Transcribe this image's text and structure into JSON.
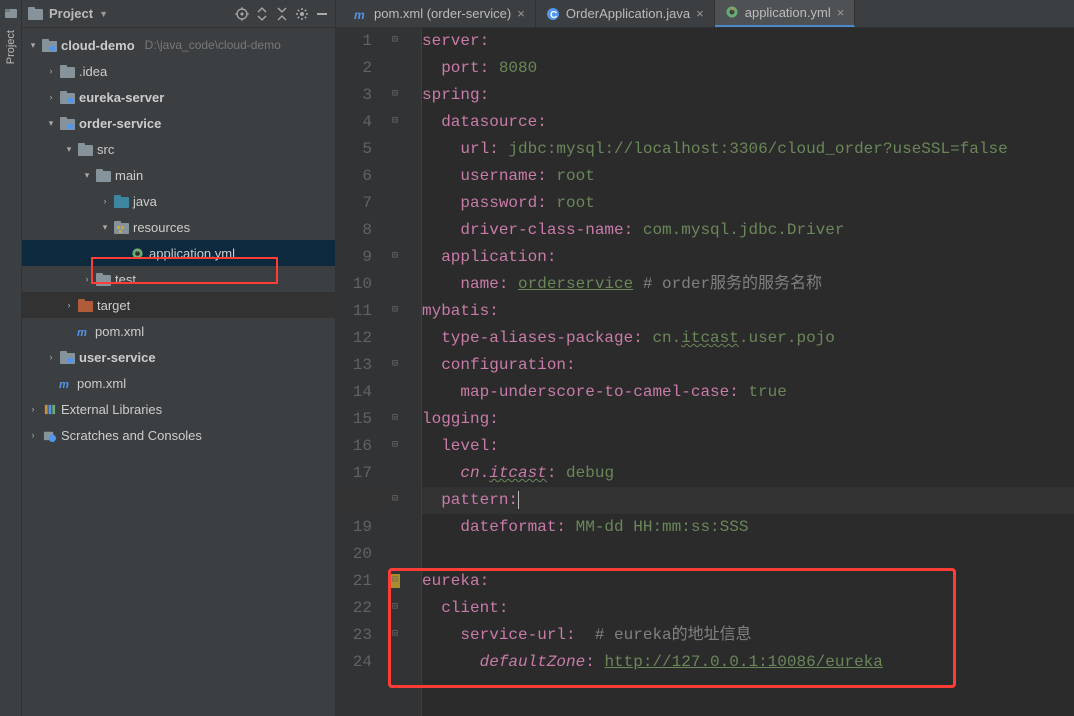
{
  "sidebar": {
    "title": "Project",
    "root": {
      "label": "cloud-demo",
      "hint": "D:\\java_code\\cloud-demo"
    },
    "nodes": {
      "idea": ".idea",
      "eureka": "eureka-server",
      "order": "order-service",
      "src": "src",
      "main": "main",
      "java": "java",
      "resources": "resources",
      "appyml": "application.yml",
      "test": "test",
      "target": "target",
      "pom1": "pom.xml",
      "user": "user-service",
      "pom2": "pom.xml",
      "extlib": "External Libraries",
      "scratch": "Scratches and Consoles"
    }
  },
  "tabs": {
    "t1": "pom.xml (order-service)",
    "t2": "OrderApplication.java",
    "t3": "application.yml"
  },
  "code": {
    "l1a": "server",
    "l1b": ":",
    "l2a": "  port",
    "l2b": ": ",
    "l2c": "8080",
    "l3a": "spring",
    "l3b": ":",
    "l4a": "  datasource",
    "l4b": ":",
    "l5a": "    url",
    "l5b": ": ",
    "l5c": "jdbc:mysql://localhost:3306/cloud_order?useSSL=false",
    "l6a": "    username",
    "l6b": ": ",
    "l6c": "root",
    "l7a": "    password",
    "l7b": ": ",
    "l7c": "root",
    "l8a": "    driver-class-name",
    "l8b": ": ",
    "l8c": "com.mysql.jdbc.Driver",
    "l9a": "  application",
    "l9b": ":",
    "l10a": "    name",
    "l10b": ": ",
    "l10c": "orderservice",
    "l10d": " # order服务的服务名称",
    "l11a": "mybatis",
    "l11b": ":",
    "l12a": "  type-aliases-package",
    "l12b": ": ",
    "l12c": "cn.",
    "l12d": "itcast",
    "l12e": ".user.pojo",
    "l13a": "  configuration",
    "l13b": ":",
    "l14a": "    map-underscore-to-camel-case",
    "l14b": ": ",
    "l14c": "true",
    "l15a": "logging",
    "l15b": ":",
    "l16a": "  level",
    "l16b": ":",
    "l17a": "    cn",
    "l17b": ".",
    "l17c": "itcast",
    "l17d": ": ",
    "l17e": "debug",
    "l18a": "  pattern",
    "l18b": ":",
    "l19a": "    dateformat",
    "l19b": ": ",
    "l19c": "MM-dd HH:mm:ss:SSS",
    "l21a": "eureka",
    "l21b": ":",
    "l22a": "  client",
    "l22b": ":",
    "l23a": "    service-url",
    "l23b": ":  ",
    "l23c": "# eureka的地址信息",
    "l24a": "      defaultZone",
    "l24b": ": ",
    "l24c": "http://127.0.0.1:10086/eureka"
  },
  "left_tab": "Project"
}
